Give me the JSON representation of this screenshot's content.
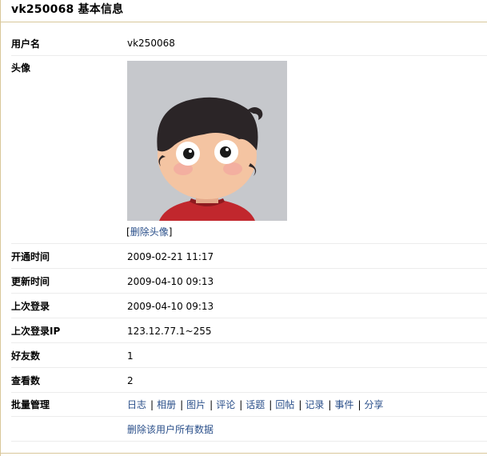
{
  "page": {
    "title": "vk250068 基本信息"
  },
  "rows": [
    {
      "label": "用户名",
      "value": "vk250068"
    },
    {
      "label": "头像",
      "value": ""
    },
    {
      "label": "开通时间",
      "value": "2009-02-21 11:17"
    },
    {
      "label": "更新时间",
      "value": "2009-04-10 09:13"
    },
    {
      "label": "上次登录",
      "value": "2009-04-10 09:13"
    },
    {
      "label": "上次登录IP",
      "value": "123.12.77.1~255"
    },
    {
      "label": "好友数",
      "value": "1"
    },
    {
      "label": "查看数",
      "value": "2"
    },
    {
      "label": "批量管理",
      "value": ""
    }
  ],
  "avatar": {
    "delete_link": "删除头像",
    "bracket_open": "[",
    "bracket_close": "]"
  },
  "actions": {
    "items": [
      "日志",
      "相册",
      "图片",
      "评论",
      "话题",
      "回帖",
      "记录",
      "事件",
      "分享"
    ],
    "separator": "|",
    "delete_all": "删除该用户所有数据"
  },
  "colors": {
    "link": "#2a4f8a",
    "border": "#d9c79a",
    "avatar_bg": "#c6c8cc"
  }
}
